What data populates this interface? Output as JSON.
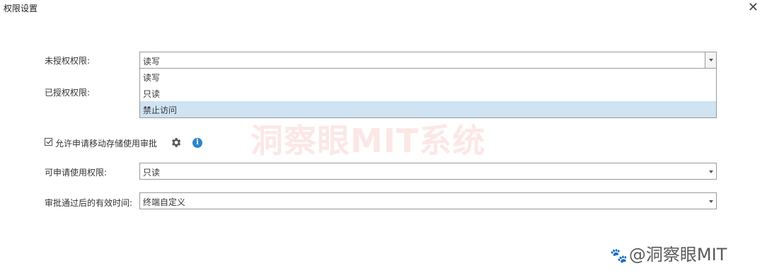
{
  "window": {
    "title": "权限设置",
    "close_symbol": "✕"
  },
  "unauthorized": {
    "label": "未授权权限:",
    "value": "读写",
    "options": [
      "读写",
      "只读",
      "禁止访问"
    ],
    "highlighted": "禁止访问"
  },
  "authorized": {
    "label": "已授权权限:"
  },
  "allow_request": {
    "label": "允许申请移动存储使用审批",
    "checked": true,
    "settings_icon": "gear-icon",
    "info_icon": "info-icon",
    "info_symbol": "i"
  },
  "requestable": {
    "label": "可申请使用权限:",
    "value": "只读"
  },
  "valid_time": {
    "label": "审批通过后的有效时间:",
    "value": "终端自定义"
  },
  "watermark": {
    "text": "洞察眼MIT系统"
  },
  "credit": {
    "text": "@洞察眼MIT",
    "paw": "🐾"
  },
  "colors": {
    "highlight": "#cfe3f3",
    "info": "#2a86d0",
    "border": "#9a9a9a"
  }
}
